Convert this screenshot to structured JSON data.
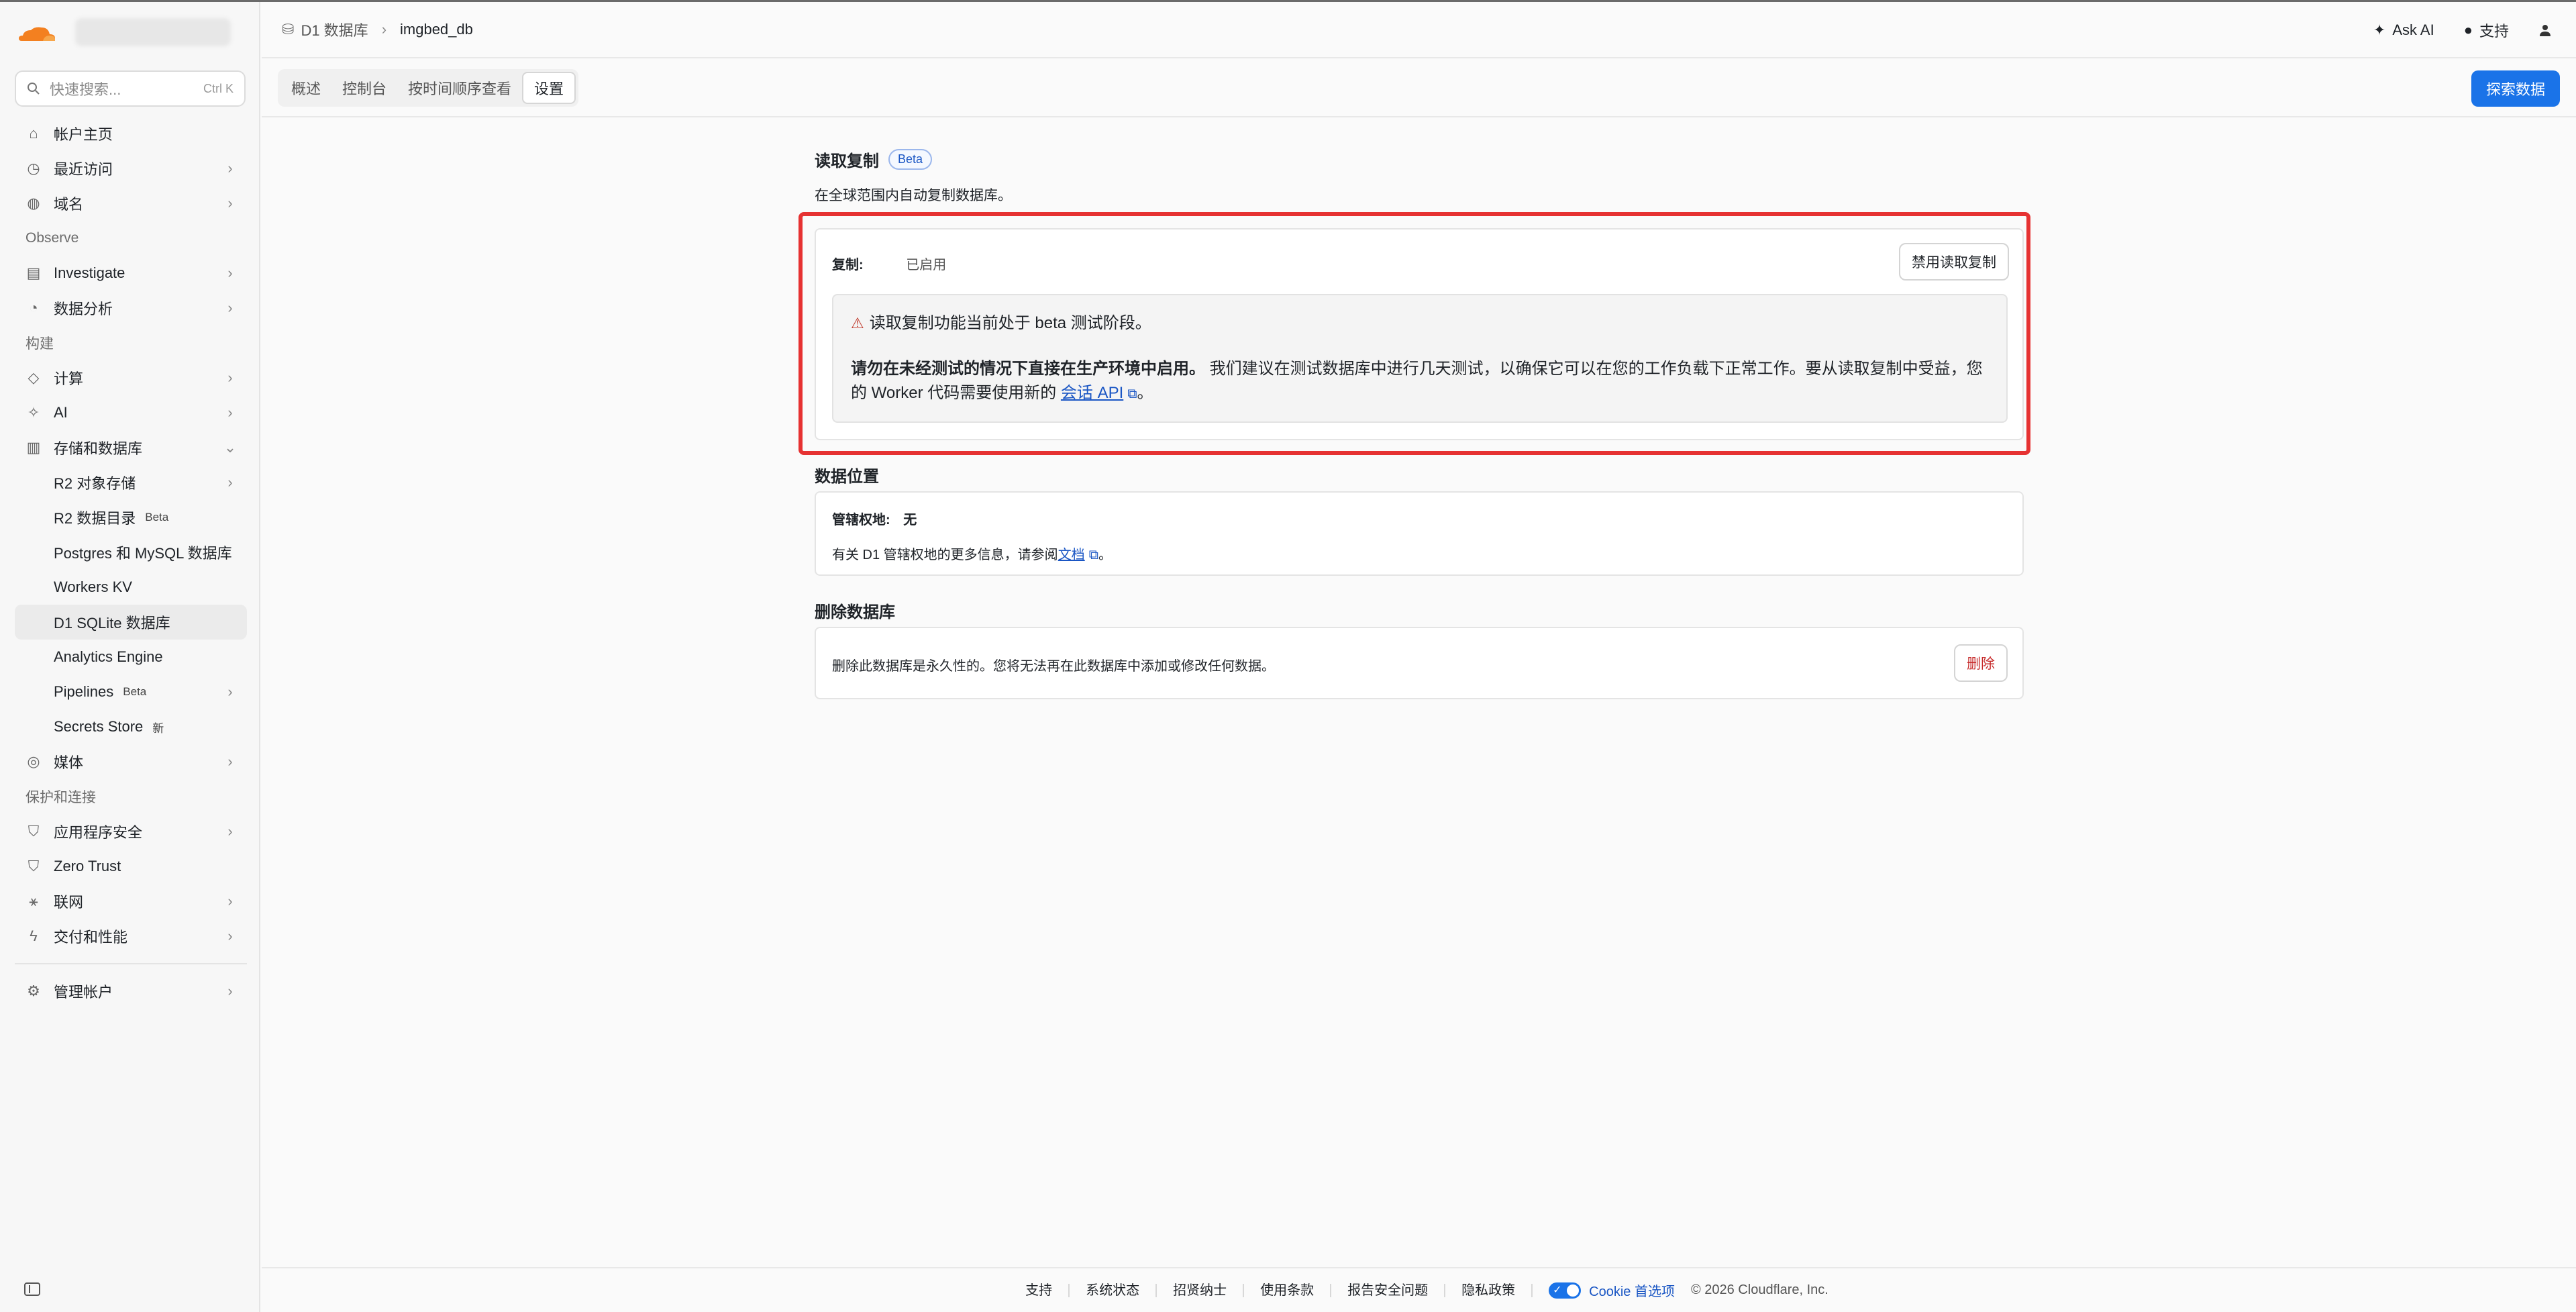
{
  "sidebar": {
    "search_placeholder": "快速搜索...",
    "search_shortcut": "Ctrl K",
    "items_top": [
      {
        "label": "帐户主页"
      },
      {
        "label": "最近访问"
      },
      {
        "label": "域名"
      }
    ],
    "section_observe": "Observe",
    "items_observe": [
      {
        "label": "Investigate"
      },
      {
        "label": "数据分析"
      }
    ],
    "section_build": "构建",
    "items_build": [
      {
        "label": "计算"
      },
      {
        "label": "AI"
      },
      {
        "label": "存储和数据库"
      }
    ],
    "storage_sub": [
      {
        "label": "R2 对象存储"
      },
      {
        "label": "R2 数据目录",
        "badge": "Beta"
      },
      {
        "label": "Postgres 和 MySQL 数据库"
      },
      {
        "label": "Workers KV"
      },
      {
        "label": "D1 SQLite 数据库"
      },
      {
        "label": "Analytics Engine"
      },
      {
        "label": "Pipelines",
        "badge": "Beta"
      },
      {
        "label": "Secrets Store",
        "badge": "新"
      }
    ],
    "item_media": "媒体",
    "section_protect": "保护和连接",
    "items_protect": [
      {
        "label": "应用程序安全"
      },
      {
        "label": "Zero Trust"
      },
      {
        "label": "联网"
      },
      {
        "label": "交付和性能"
      }
    ],
    "item_manage": "管理帐户"
  },
  "header": {
    "crumb_parent": "D1 数据库",
    "crumb_current": "imgbed_db",
    "ask_ai": "Ask AI",
    "support": "支持"
  },
  "subnav": {
    "tabs": [
      "概述",
      "控制台",
      "按时间顺序查看",
      "设置"
    ],
    "explore_button": "探索数据"
  },
  "replication": {
    "title": "读取复制",
    "beta": "Beta",
    "description": "在全球范围内自动复制数据库。",
    "label": "复制:",
    "status": "已启用",
    "disable_button": "禁用读取复制",
    "warning_title": "读取复制功能当前处于 beta 测试阶段。",
    "warning_bold": "请勿在未经测试的情况下直接在生产环境中启用。",
    "warning_text": "我们建议在测试数据库中进行几天测试，以确保它可以在您的工作负载下正常工作。要从读取复制中受益，您的 Worker 代码需要使用新的",
    "warning_link": "会话 API",
    "warning_end": "。"
  },
  "location": {
    "title": "数据位置",
    "label": "管辖权地:",
    "value": "无",
    "info_prefix": "有关 D1 管辖权地的更多信息，请参阅",
    "info_link": "文档",
    "info_end": "。"
  },
  "delete": {
    "title": "删除数据库",
    "text": "删除此数据库是永久性的。您将无法再在此数据库中添加或修改任何数据。",
    "button": "删除"
  },
  "footer": {
    "links": [
      "支持",
      "系统状态",
      "招贤纳士",
      "使用条款",
      "报告安全问题",
      "隐私政策"
    ],
    "cookie": "Cookie 首选项",
    "copyright": "© 2026 Cloudflare, Inc."
  },
  "colors": {
    "accent": "#1a73e8",
    "highlight": "#e63232",
    "danger": "#c62828",
    "brand": "#f38020"
  }
}
